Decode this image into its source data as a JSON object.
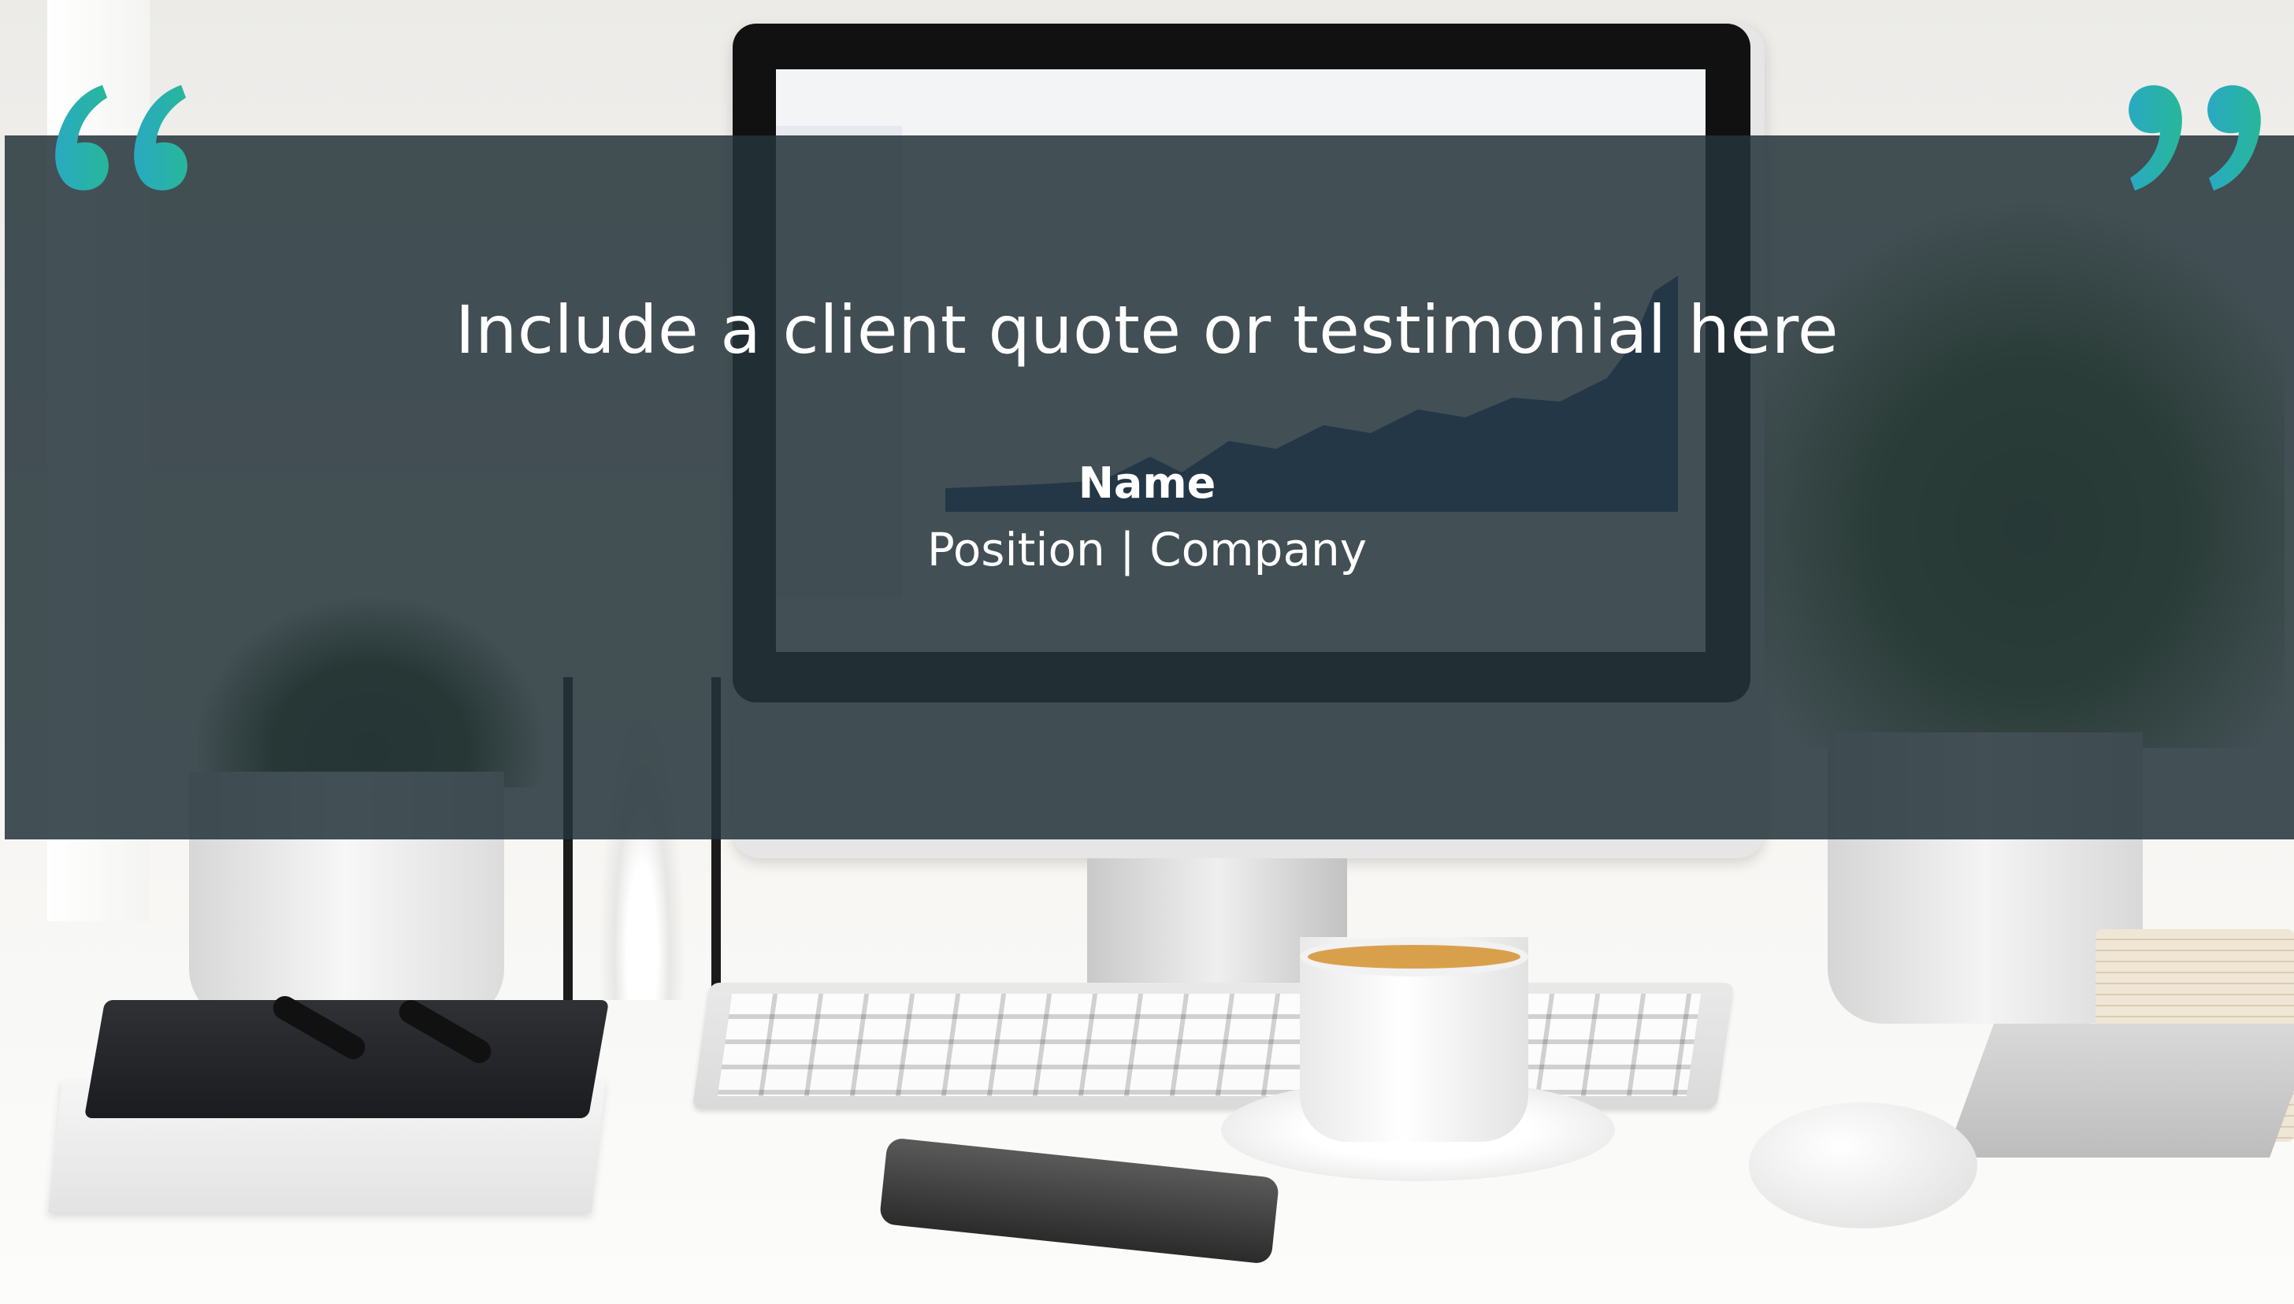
{
  "testimonial": {
    "quote": "Include a client quote or testimonial here",
    "name": "Name",
    "position_company": "Position | Company"
  },
  "decor": {
    "open_quote_icon": "open-quotation-mark-icon",
    "close_quote_icon": "close-quotation-mark-icon",
    "quote_gradient_colors": [
      "#2aa9c2",
      "#27b79a"
    ],
    "overlay_color": "#243339"
  }
}
